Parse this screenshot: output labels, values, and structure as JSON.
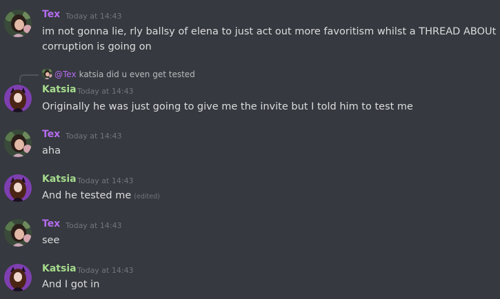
{
  "users": {
    "tex": {
      "name": "Tex",
      "avatar_icon": "tex-avatar-icon",
      "color": "#b56cf1"
    },
    "katsia": {
      "name": "Katsia",
      "avatar_icon": "katsia-avatar-icon",
      "color": "#a6dc8e"
    }
  },
  "messages": [
    {
      "author": "Tex",
      "timestamp": "Today at 14:43",
      "lines": [
        "im not gonna lie, rly ballsy of elena to just act out more favoritism whilst a THREAD ABOUt her",
        "corruption is going on"
      ]
    },
    {
      "author": "Katsia",
      "timestamp": "Today at 14:43",
      "reply": {
        "mention": "@Tex",
        "text": "katsia did u even get tested"
      },
      "text": "Originally he was just going to give me the invite but I told him to test me"
    },
    {
      "author": "Tex",
      "timestamp": "Today at 14:43",
      "text": "aha"
    },
    {
      "author": "Katsia",
      "timestamp": "Today at 14:43",
      "text": "And he tested me",
      "edited": "(edited)"
    },
    {
      "author": "Tex",
      "timestamp": "Today at 14:43",
      "text": "see"
    },
    {
      "author": "Katsia",
      "timestamp": "Today at 14:43",
      "text": "And I got in"
    }
  ]
}
